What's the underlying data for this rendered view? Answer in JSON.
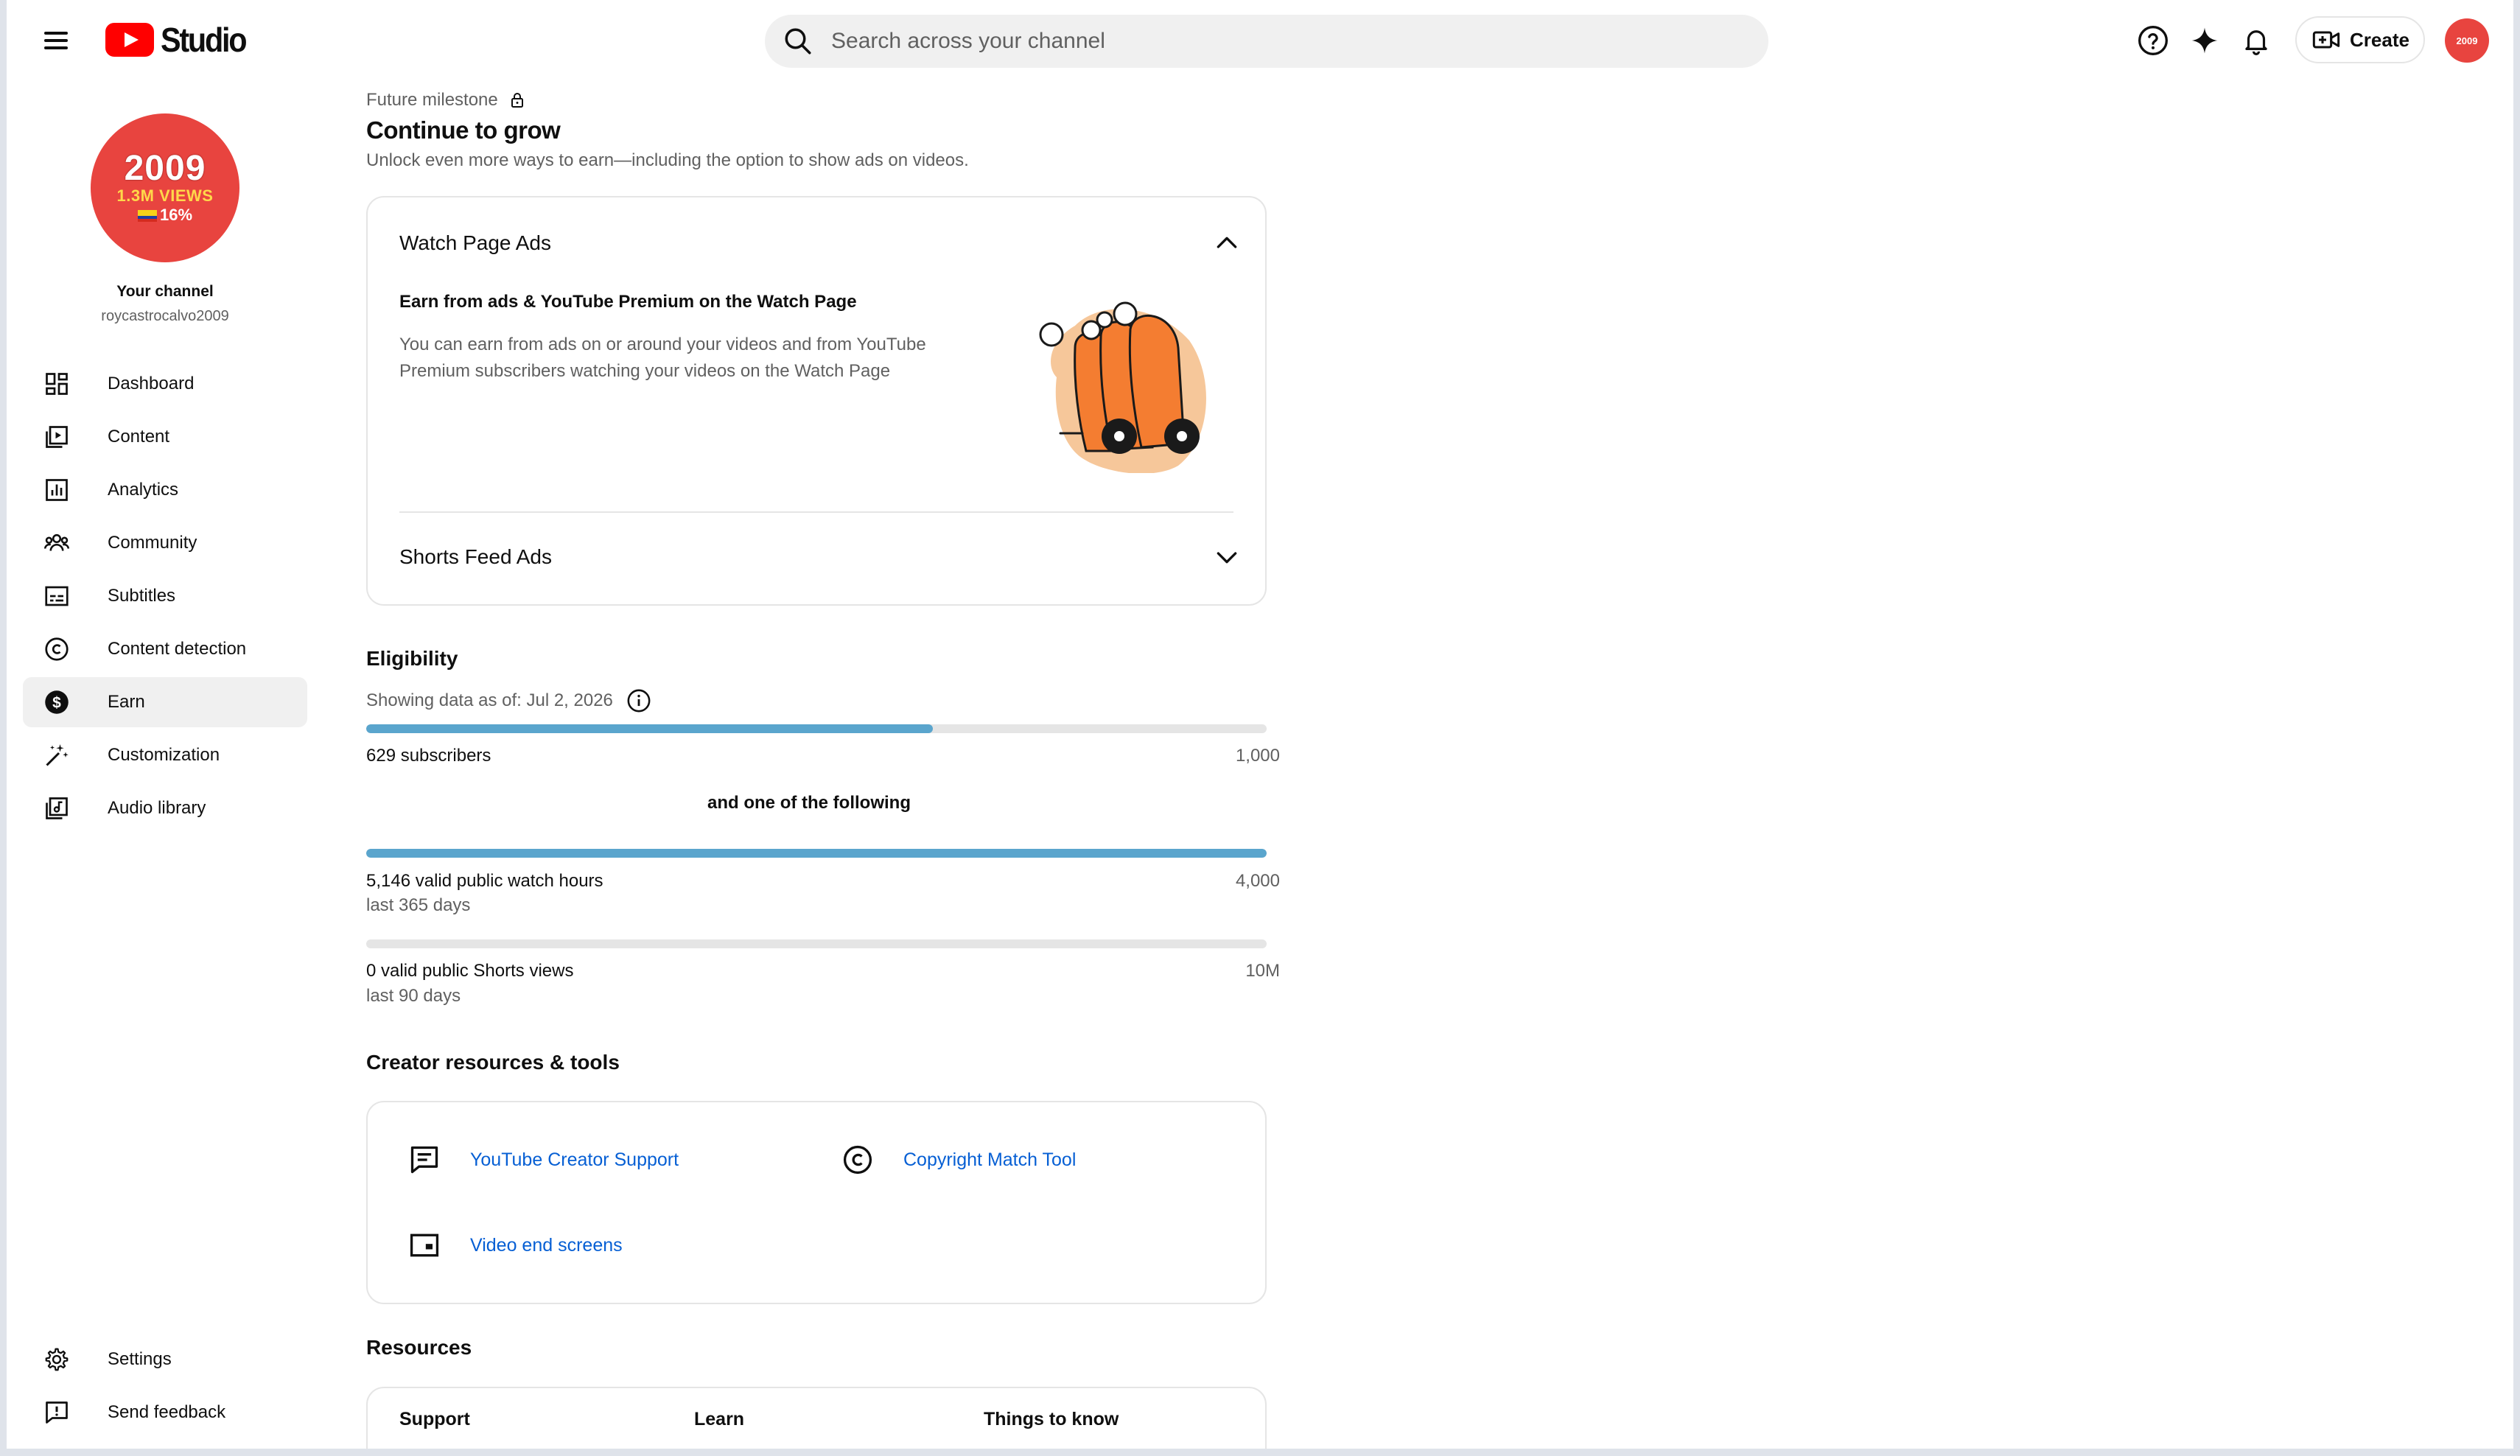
{
  "header": {
    "logo_text": "Studio",
    "search_placeholder": "Search across your channel",
    "create_label": "Create",
    "avatar_text": "2009"
  },
  "sidebar": {
    "avatar": {
      "year": "2009",
      "views": "1.3M VIEWS",
      "percent": "16%"
    },
    "channel_title": "Your channel",
    "channel_handle": "roycastrocalvo2009",
    "items": [
      {
        "label": "Dashboard",
        "icon": "dashboard-icon"
      },
      {
        "label": "Content",
        "icon": "content-icon"
      },
      {
        "label": "Analytics",
        "icon": "analytics-icon"
      },
      {
        "label": "Community",
        "icon": "community-icon"
      },
      {
        "label": "Subtitles",
        "icon": "subtitles-icon"
      },
      {
        "label": "Content detection",
        "icon": "copyright-icon"
      },
      {
        "label": "Earn",
        "icon": "dollar-icon",
        "active": true
      },
      {
        "label": "Customization",
        "icon": "magic-wand-icon"
      },
      {
        "label": "Audio library",
        "icon": "audio-library-icon"
      }
    ],
    "bottom_items": [
      {
        "label": "Settings",
        "icon": "gear-icon"
      },
      {
        "label": "Send feedback",
        "icon": "feedback-icon"
      }
    ]
  },
  "main": {
    "milestone_label": "Future milestone",
    "title": "Continue to grow",
    "subtitle": "Unlock even more ways to earn—including the option to show ads on videos.",
    "accordion": {
      "watch_title": "Watch Page Ads",
      "watch_heading": "Earn from ads & YouTube Premium on the Watch Page",
      "watch_desc": "You can earn from ads on or around your videos and from YouTube Premium subscribers watching your videos on the Watch Page",
      "shorts_title": "Shorts Feed Ads"
    },
    "eligibility": {
      "title": "Eligibility",
      "as_of": "Showing data as of: Jul 2, 2026",
      "subscribers": {
        "label": "629 subscribers",
        "target": "1,000",
        "progress": 0.629
      },
      "or_text": "and one of the following",
      "watch_hours": {
        "label": "5,146 valid public watch hours",
        "period": "last 365 days",
        "target": "4,000",
        "progress": 1.0
      },
      "shorts_views": {
        "label": "0 valid public Shorts views",
        "period": "last 90 days",
        "target": "10M",
        "progress": 0
      }
    },
    "creator_resources": {
      "title": "Creator resources & tools",
      "links": [
        {
          "label": "YouTube Creator Support",
          "icon": "chat-icon"
        },
        {
          "label": "Copyright Match Tool",
          "icon": "copyright-icon"
        },
        {
          "label": "Video end screens",
          "icon": "end-screen-icon"
        }
      ]
    },
    "resources": {
      "title": "Resources",
      "columns": [
        "Support",
        "Learn",
        "Things to know"
      ]
    }
  },
  "colors": {
    "accent_red": "#ff0000",
    "progress_blue": "#5aa5cd",
    "link_blue": "#065fd4",
    "avatar_red": "#e8443f"
  }
}
